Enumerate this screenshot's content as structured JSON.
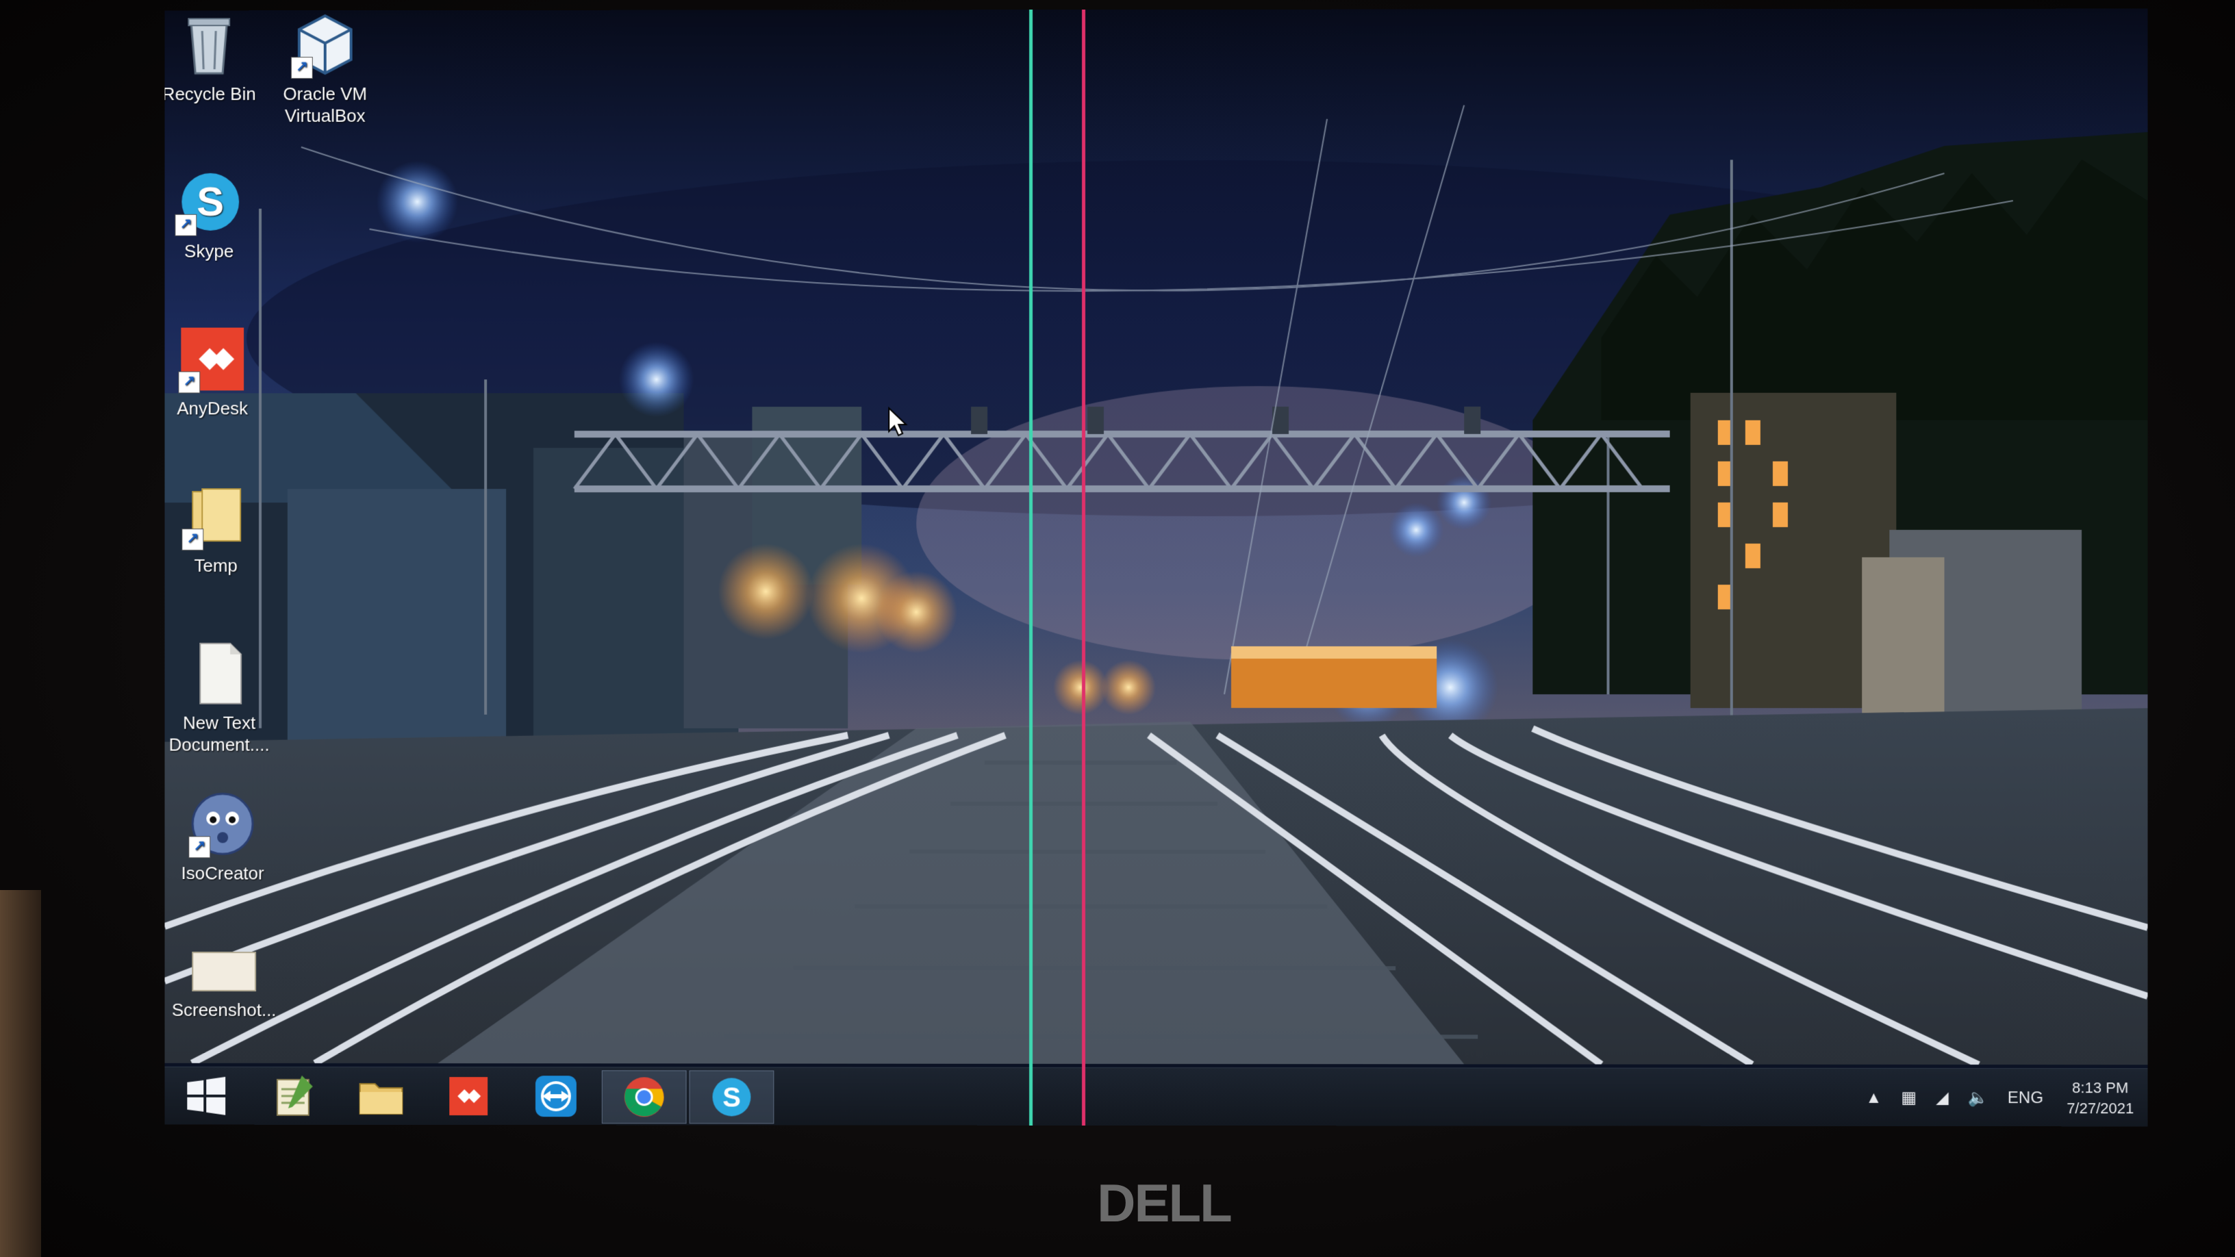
{
  "desktop": {
    "icons": [
      {
        "label": "Recycle Bin",
        "icon": "recycle-bin-icon"
      },
      {
        "label": "Oracle VM VirtualBox",
        "icon": "virtualbox-icon"
      },
      {
        "label": "Skype",
        "icon": "skype-icon"
      },
      {
        "label": "AnyDesk",
        "icon": "anydesk-icon"
      },
      {
        "label": "Temp",
        "icon": "folder-icon"
      },
      {
        "label": "New Text Document....",
        "icon": "text-document-icon"
      },
      {
        "label": "IsoCreator",
        "icon": "isocreator-icon"
      },
      {
        "label": "Screenshot...",
        "icon": "screenshot-file-icon"
      }
    ]
  },
  "taskbar": {
    "pinned": [
      {
        "name": "start",
        "icon": "windows-start-icon"
      },
      {
        "name": "notepad",
        "icon": "notepad-icon"
      },
      {
        "name": "file-explorer",
        "icon": "folder-icon"
      },
      {
        "name": "anydesk",
        "icon": "anydesk-icon"
      },
      {
        "name": "teamviewer",
        "icon": "teamviewer-icon"
      },
      {
        "name": "chrome",
        "icon": "chrome-icon",
        "active": true
      },
      {
        "name": "skype",
        "icon": "skype-icon",
        "active": true
      }
    ],
    "tray": {
      "language": "ENG",
      "time": "8:13 PM",
      "date": "7/27/2021"
    }
  },
  "bezel": {
    "brand": "DELL"
  },
  "colors": {
    "accent_green_line": "#3fd6b0",
    "accent_red_line": "#e0306a",
    "anydesk_red": "#e8412c",
    "skype_blue": "#2aa8e0"
  }
}
